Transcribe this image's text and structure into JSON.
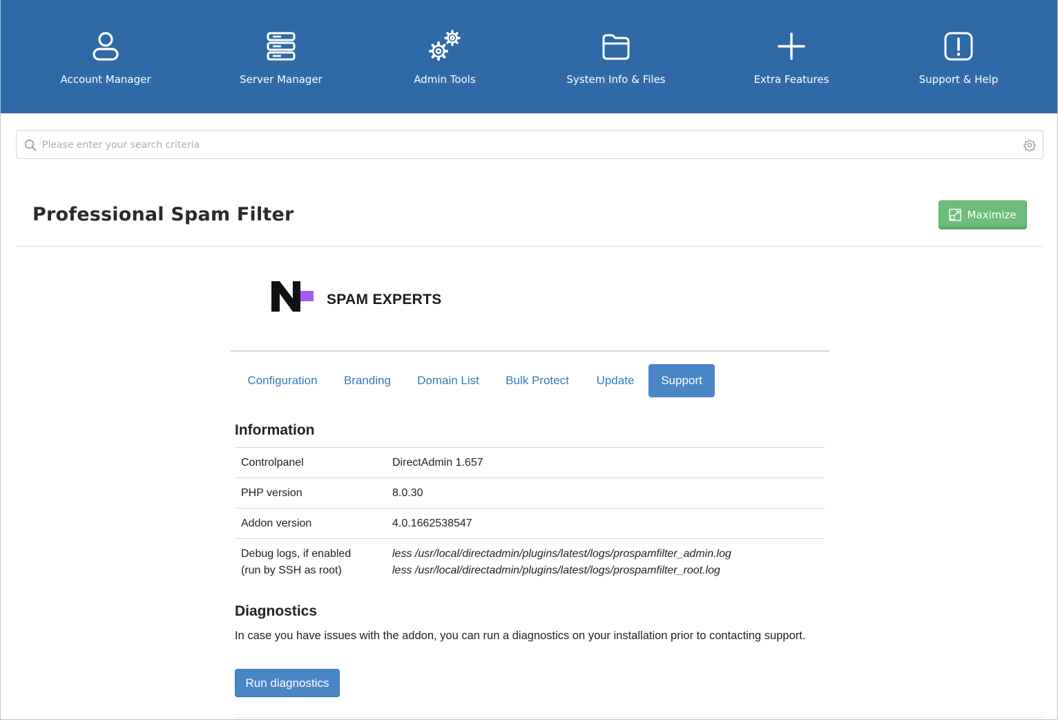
{
  "topnav": {
    "items": [
      {
        "label": "Account Manager",
        "icon": "user-icon"
      },
      {
        "label": "Server Manager",
        "icon": "server-icon"
      },
      {
        "label": "Admin Tools",
        "icon": "gears-icon"
      },
      {
        "label": "System Info & Files",
        "icon": "folder-icon"
      },
      {
        "label": "Extra Features",
        "icon": "plus-icon"
      },
      {
        "label": "Support & Help",
        "icon": "exclamation-icon"
      }
    ],
    "background": "#2f6aa7"
  },
  "search": {
    "placeholder": "Please enter your search criteria",
    "value": ""
  },
  "page": {
    "title": "Professional Spam Filter",
    "maximize_label": "Maximize"
  },
  "logo": {
    "text": "SPAM EXPERTS",
    "accent": "#a25cf6"
  },
  "tabs": [
    {
      "label": "Configuration",
      "active": false
    },
    {
      "label": "Branding",
      "active": false
    },
    {
      "label": "Domain List",
      "active": false
    },
    {
      "label": "Bulk Protect",
      "active": false
    },
    {
      "label": "Update",
      "active": false
    },
    {
      "label": "Support",
      "active": true
    }
  ],
  "information": {
    "title": "Information",
    "rows": [
      {
        "key": "Controlpanel",
        "value": "DirectAdmin 1.657"
      },
      {
        "key": "PHP version",
        "value": "8.0.30"
      },
      {
        "key": "Addon version",
        "value": "4.0.1662538547"
      },
      {
        "key_line1": "Debug logs, if enabled",
        "key_line2": "(run by SSH as root)",
        "value_line1": "less /usr/local/directadmin/plugins/latest/logs/prospamfilter_admin.log",
        "value_line2": "less /usr/local/directadmin/plugins/latest/logs/prospamfilter_root.log"
      }
    ]
  },
  "diagnostics": {
    "title": "Diagnostics",
    "text": "In case you have issues with the addon, you can run a diagnostics on your installation prior to contacting support.",
    "button_label": "Run diagnostics"
  },
  "colors": {
    "link": "#337ab7",
    "primary_button": "#4a86c6",
    "maximize_button": "#6dbd7a"
  }
}
